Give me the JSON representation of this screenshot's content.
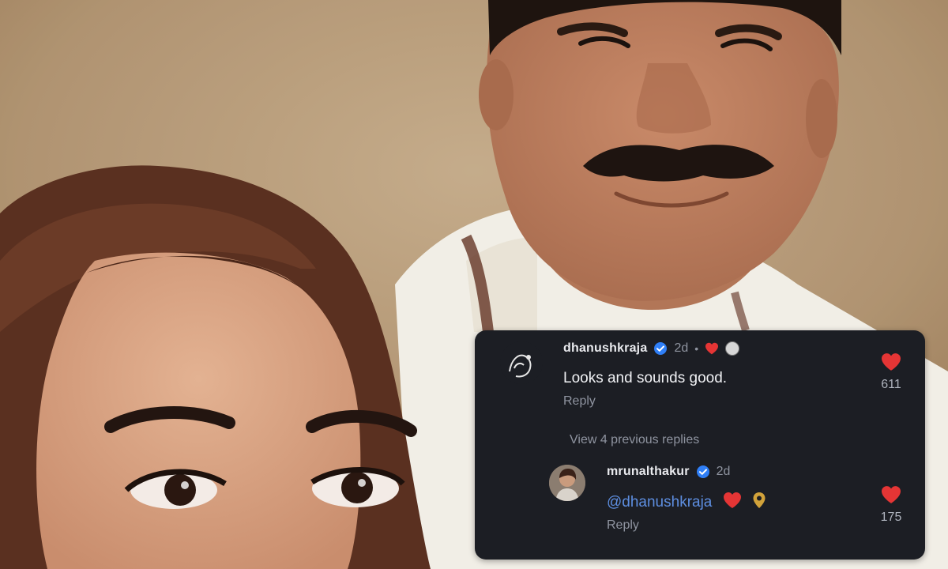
{
  "photo": {
    "description_icon": "selfie-photo-icon"
  },
  "comment_panel": {
    "comments": [
      {
        "username": "dhanushkraja",
        "time": "2d",
        "separator": "•",
        "text": "Looks and sounds good.",
        "reply_label": "Reply",
        "like_count": "611"
      },
      {
        "username": "mrunalthakur",
        "time": "2d",
        "text": "@dhanushkraja",
        "reply_label": "Reply",
        "like_count": "175"
      }
    ],
    "view_previous_label": "View 4 previous replies"
  },
  "colors": {
    "panel_bg": "#1c1e24",
    "like_red": "#e53535",
    "verified_blue": "#2f7ff7",
    "mention_blue": "#5d8ee0"
  }
}
